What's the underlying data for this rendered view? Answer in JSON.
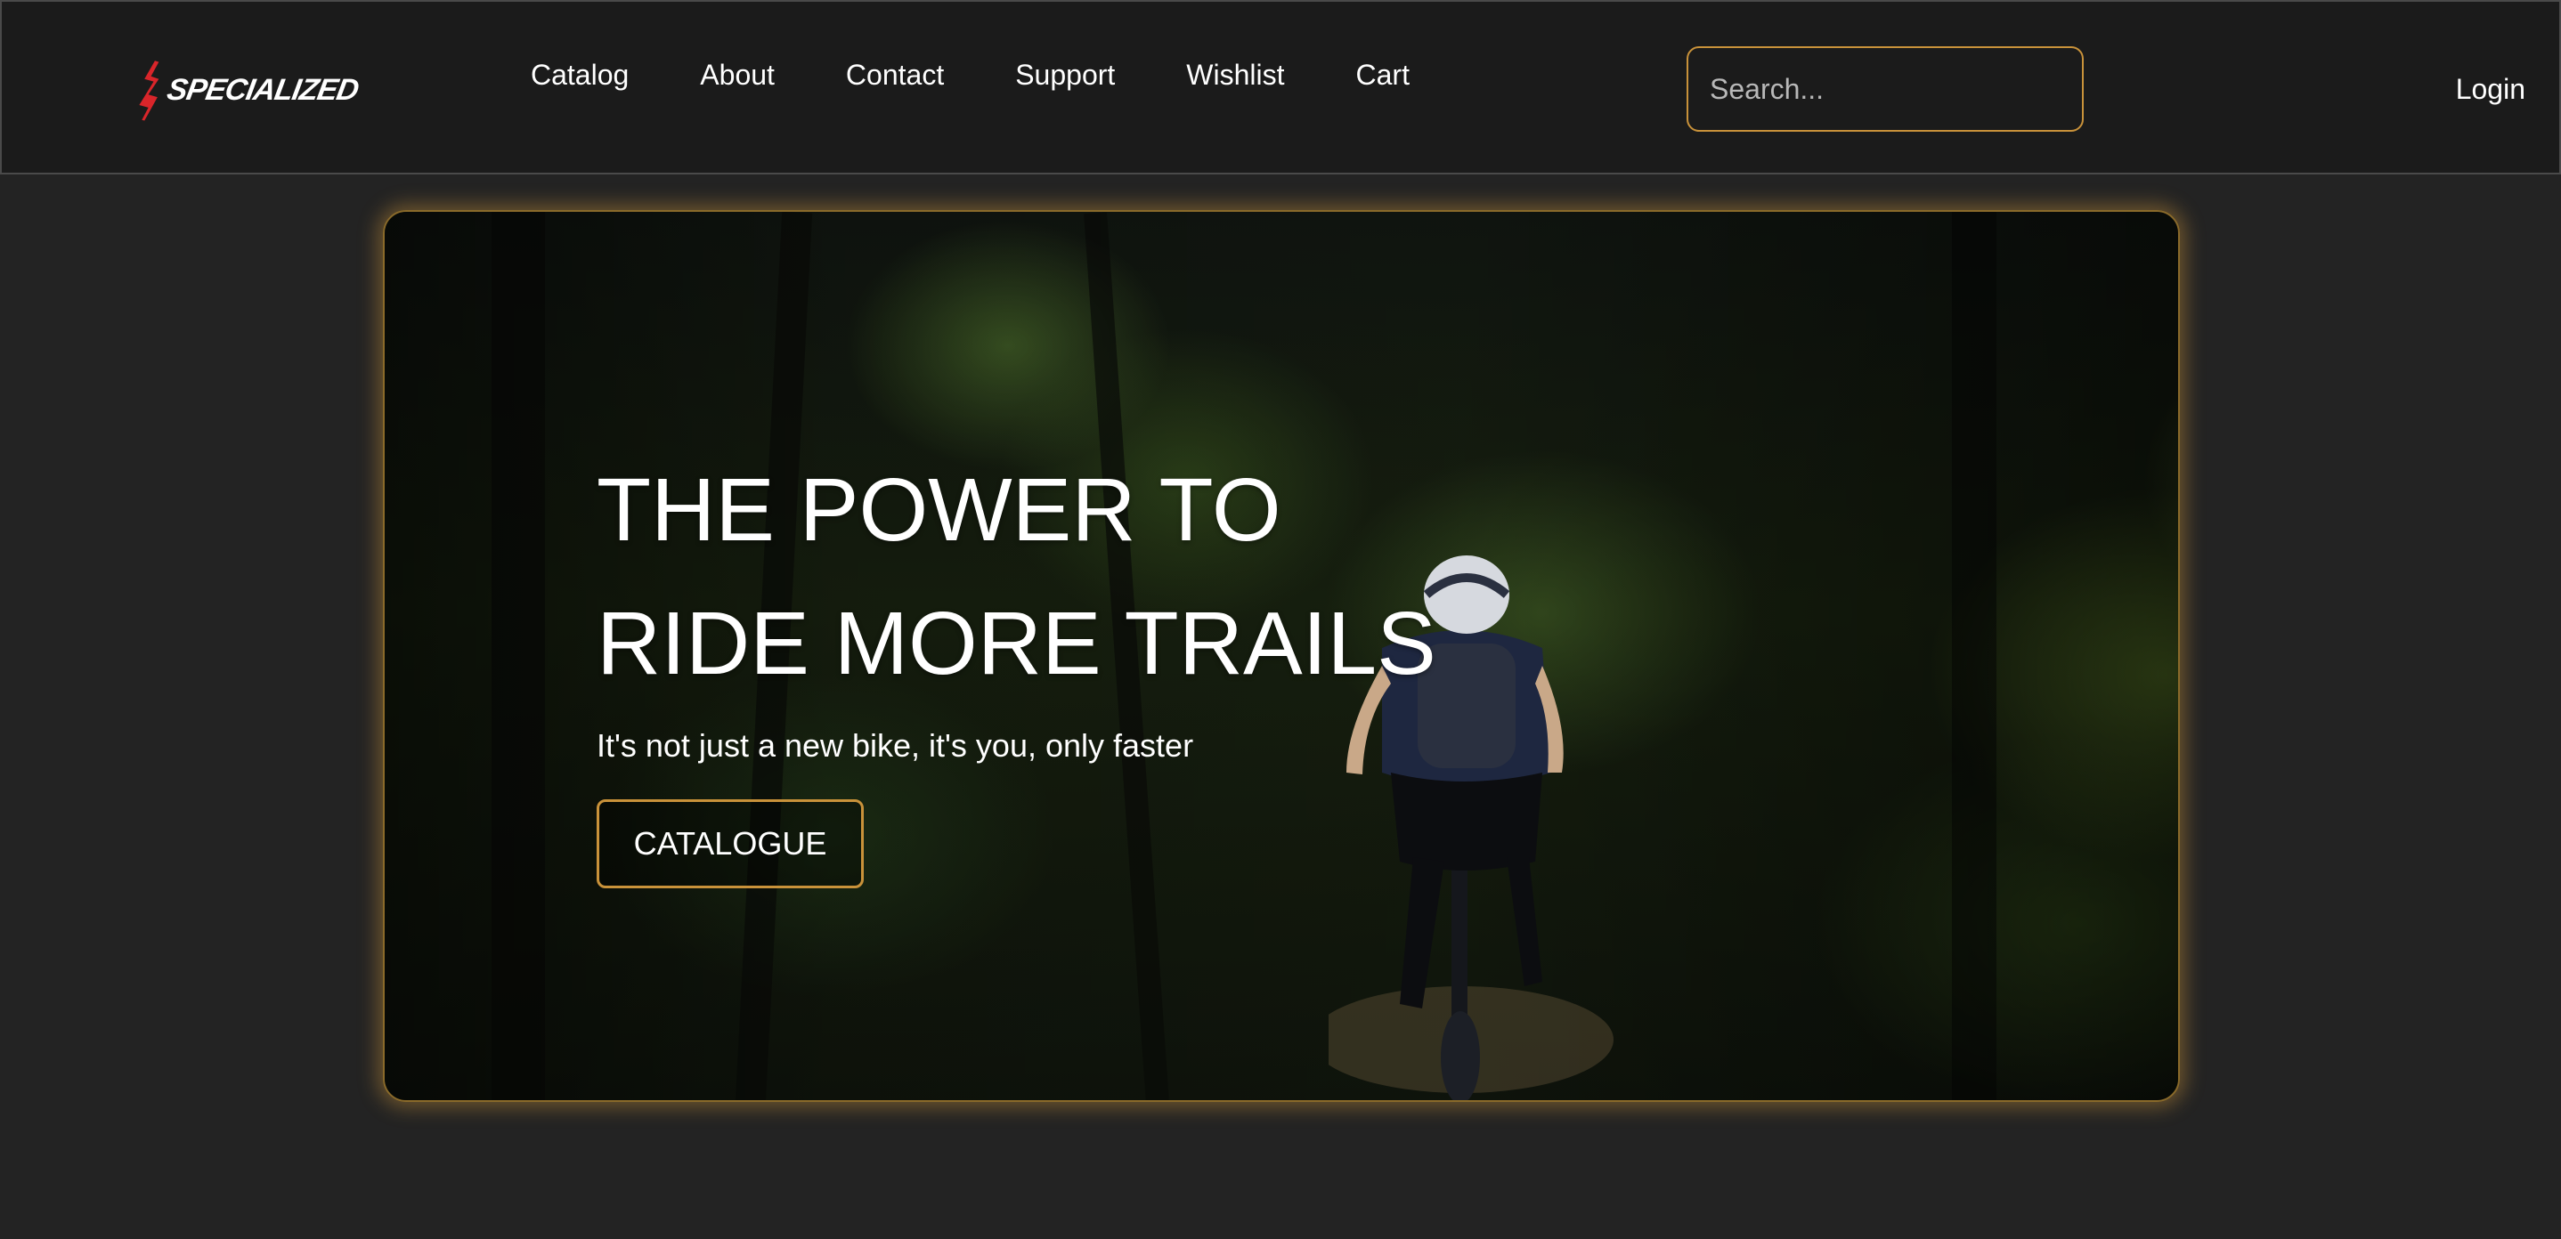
{
  "brand": {
    "name": "SPECIALIZED",
    "accent_color": "#d9252a"
  },
  "nav": {
    "links": [
      "Catalog",
      "About",
      "Contact",
      "Support",
      "Wishlist",
      "Cart"
    ]
  },
  "search": {
    "placeholder": "Search...",
    "icon": "search-icon",
    "border_color": "#c9923a"
  },
  "account": {
    "login_label": "Login"
  },
  "hero": {
    "title_line1": "THE POWER TO",
    "title_line2": "RIDE MORE TRAILS",
    "subtitle": "It's not just a new bike, it's you, only faster",
    "cta_label": "CATALOGUE",
    "image": "mountain biker riding through a forest trail",
    "glow_color": "#c9923a"
  }
}
